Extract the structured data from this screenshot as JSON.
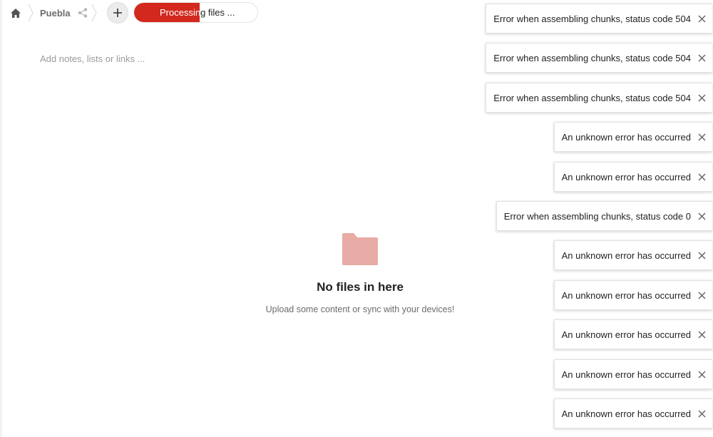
{
  "breadcrumb": {
    "folder_label": "Puebla"
  },
  "progress": {
    "label": "Processing files ...",
    "fraction": 0.53
  },
  "notes": {
    "placeholder": "Add notes, lists or links ..."
  },
  "empty_state": {
    "title": "No files in here",
    "subtitle": "Upload some content or sync with your devices!"
  },
  "toasts": [
    {
      "message": "Error when assembling chunks, status code 504"
    },
    {
      "message": "Error when assembling chunks, status code 504"
    },
    {
      "message": "Error when assembling chunks, status code 504"
    },
    {
      "message": "An unknown error has occurred"
    },
    {
      "message": "An unknown error has occurred"
    },
    {
      "message": "Error when assembling chunks, status code 0"
    },
    {
      "message": "An unknown error has occurred"
    },
    {
      "message": "An unknown error has occurred"
    },
    {
      "message": "An unknown error has occurred"
    },
    {
      "message": "An unknown error has occurred"
    },
    {
      "message": "An unknown error has occurred"
    }
  ],
  "colors": {
    "accent": "#d2281e",
    "folder": "#e9aba5"
  }
}
